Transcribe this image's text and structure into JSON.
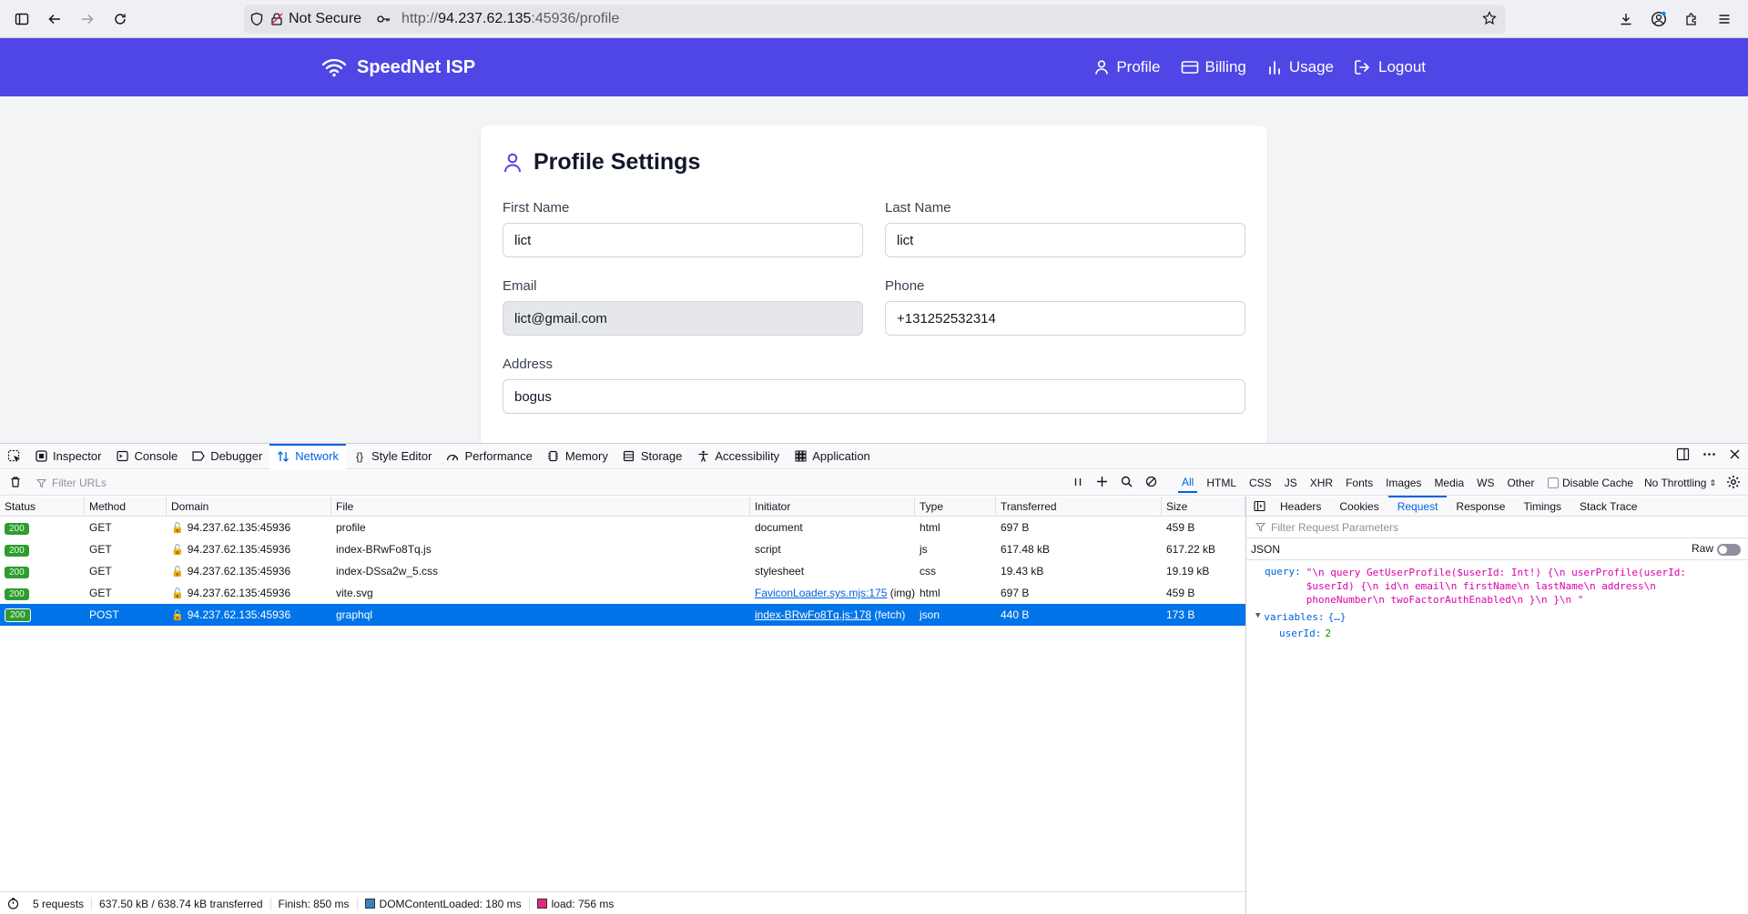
{
  "browser": {
    "security_label": "Not Secure",
    "url_prefix": "http://",
    "url_host": "94.237.62.135",
    "url_rest": ":45936/profile"
  },
  "site": {
    "brand": "SpeedNet ISP",
    "nav": [
      "Profile",
      "Billing",
      "Usage",
      "Logout"
    ],
    "accent_color": "#4f46e5"
  },
  "profile": {
    "title": "Profile Settings",
    "first_name_label": "First Name",
    "first_name": "lict",
    "last_name_label": "Last Name",
    "last_name": "lict",
    "email_label": "Email",
    "email": "lict@gmail.com",
    "phone_label": "Phone",
    "phone": "+131252532314",
    "address_label": "Address",
    "address": "bogus"
  },
  "devtools": {
    "tabs": [
      "Inspector",
      "Console",
      "Debugger",
      "Network",
      "Style Editor",
      "Performance",
      "Memory",
      "Storage",
      "Accessibility",
      "Application"
    ],
    "active_tab": "Network",
    "filter_placeholder": "Filter URLs",
    "type_filters": [
      "All",
      "HTML",
      "CSS",
      "JS",
      "XHR",
      "Fonts",
      "Images",
      "Media",
      "WS",
      "Other"
    ],
    "disable_cache": "Disable Cache",
    "throttling": "No Throttling",
    "columns": [
      "Status",
      "Method",
      "Domain",
      "File",
      "Initiator",
      "Type",
      "Transferred",
      "Size"
    ],
    "requests": [
      {
        "status": "200",
        "method": "GET",
        "domain": "94.237.62.135:45936",
        "file": "profile",
        "initiator": "document",
        "initiator_link": "",
        "initiator_suffix": "",
        "type": "html",
        "transferred": "697 B",
        "size": "459 B"
      },
      {
        "status": "200",
        "method": "GET",
        "domain": "94.237.62.135:45936",
        "file": "index-BRwFo8Tq.js",
        "initiator": "script",
        "initiator_link": "",
        "initiator_suffix": "",
        "type": "js",
        "transferred": "617.48 kB",
        "size": "617.22 kB"
      },
      {
        "status": "200",
        "method": "GET",
        "domain": "94.237.62.135:45936",
        "file": "index-DSsa2w_5.css",
        "initiator": "stylesheet",
        "initiator_link": "",
        "initiator_suffix": "",
        "type": "css",
        "transferred": "19.43 kB",
        "size": "19.19 kB"
      },
      {
        "status": "200",
        "method": "GET",
        "domain": "94.237.62.135:45936",
        "file": "vite.svg",
        "initiator": "",
        "initiator_link": "FaviconLoader.sys.mjs:175",
        "initiator_suffix": " (img)",
        "type": "html",
        "transferred": "697 B",
        "size": "459 B"
      },
      {
        "status": "200",
        "method": "POST",
        "domain": "94.237.62.135:45936",
        "file": "graphql",
        "initiator": "",
        "initiator_link": "index-BRwFo8Tq.js:178",
        "initiator_suffix": " (fetch)",
        "type": "json",
        "transferred": "440 B",
        "size": "173 B"
      }
    ],
    "selected_request_index": 4,
    "status_bar": {
      "requests": "5 requests",
      "transferred": "637.50 kB / 638.74 kB transferred",
      "finish": "Finish: 850 ms",
      "dom_content_loaded": "DOMContentLoaded: 180 ms",
      "load": "load: 756 ms"
    },
    "side_panel": {
      "tabs": [
        "Headers",
        "Cookies",
        "Request",
        "Response",
        "Timings",
        "Stack Trace"
      ],
      "active_tab": "Request",
      "filter_placeholder": "Filter Request Parameters",
      "format_label": "JSON",
      "raw_label": "Raw",
      "query_key": "query:",
      "query_value": "\"\\n query GetUserProfile($userId: Int!) {\\n userProfile(userId: $userId) {\\n id\\n email\\n firstName\\n lastName\\n address\\n phoneNumber\\n twoFactorAuthEnabled\\n }\\n }\\n \"",
      "variables_key": "variables:",
      "variables_value": "{…}",
      "userid_key": "userId:",
      "userid_value": "2"
    }
  }
}
